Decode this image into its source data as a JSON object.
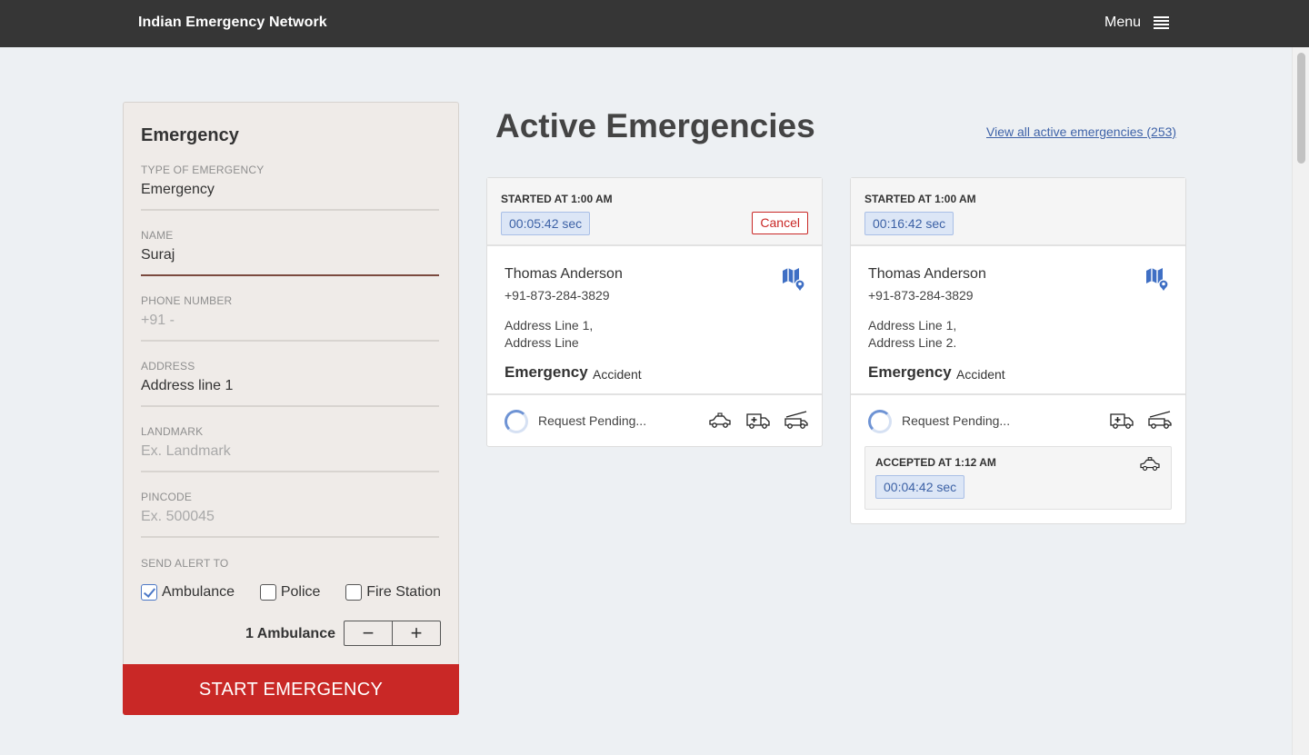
{
  "header": {
    "brand": "Indian Emergency Network",
    "menu_label": "Menu"
  },
  "form": {
    "title": "Emergency",
    "fields": [
      {
        "label": "TYPE OF EMERGENCY",
        "value": "Emergency",
        "placeholder": ""
      },
      {
        "label": "NAME",
        "value": "Suraj",
        "placeholder": ""
      },
      {
        "label": "PHONE NUMBER",
        "value": "",
        "placeholder": "+91 -"
      },
      {
        "label": "ADDRESS",
        "value": "Address line 1",
        "placeholder": ""
      },
      {
        "label": "LANDMARK",
        "value": "",
        "placeholder": "Ex. Landmark"
      },
      {
        "label": "PINCODE",
        "value": "",
        "placeholder": "Ex. 500045"
      }
    ],
    "send_alert_label": "SEND ALERT TO",
    "alerts": [
      {
        "label": "Ambulance",
        "checked": true
      },
      {
        "label": "Police",
        "checked": false
      },
      {
        "label": "Fire Station",
        "checked": false
      }
    ],
    "count_label": "1 Ambulance",
    "minus": "−",
    "plus": "+",
    "start_button": "START EMERGENCY"
  },
  "main": {
    "heading": "Active Emergencies",
    "view_all": "View all active emergencies (253)"
  },
  "cards": [
    {
      "started": "STARTED AT 1:00 AM",
      "timer": "00:05:42 sec",
      "cancel": "Cancel",
      "name": "Thomas Anderson",
      "phone": "+91-873-284-3829",
      "address_line1": "Address Line 1,",
      "address_line2": "Address Line",
      "type": "Emergency",
      "category": "Accident",
      "status": "Request Pending...",
      "vehicles": [
        "police-car-icon",
        "ambulance-icon",
        "fire-truck-icon"
      ]
    },
    {
      "started": "STARTED AT 1:00 AM",
      "timer": "00:16:42 sec",
      "name": "Thomas Anderson",
      "phone": "+91-873-284-3829",
      "address_line1": "Address Line 1,",
      "address_line2": "Address Line 2.",
      "type": "Emergency",
      "category": "Accident",
      "status": "Request Pending...",
      "vehicles": [
        "ambulance-icon",
        "fire-truck-icon"
      ],
      "accepted": {
        "label": "ACCEPTED AT 1:12 AM",
        "timer": "00:04:42 sec",
        "vehicle": "police-car-icon"
      }
    }
  ],
  "colors": {
    "topbar": "#363636",
    "accent_red": "#c92826",
    "timer_blue": "#3d62a6",
    "map_blue": "#3f6fc4"
  }
}
